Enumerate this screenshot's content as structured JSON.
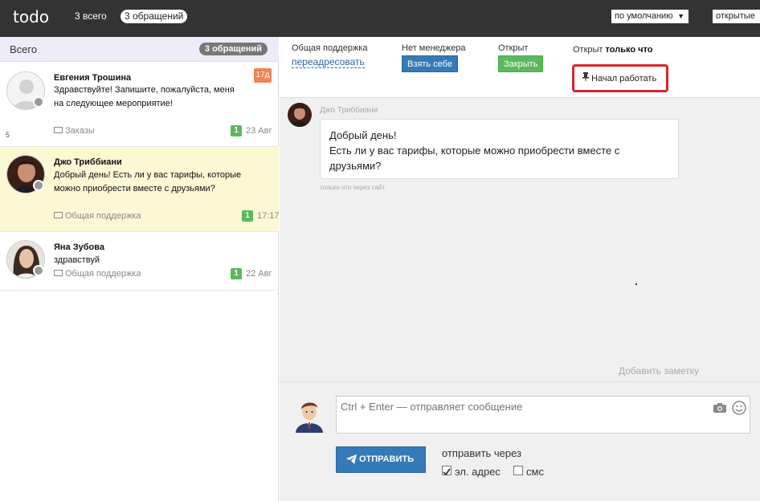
{
  "topbar": {
    "logo": "todo",
    "all_label": "3 всего",
    "requests_badge": "3 обращений",
    "sort_select": "по умолчанию",
    "filter_select": "открытые"
  },
  "sidebar": {
    "title": "Всего",
    "badge": "3 обращений",
    "side_number": "5",
    "conversations": [
      {
        "name": "Евгения Трошина",
        "age_badge": "17д",
        "text": "Здравствуйте! Запишите, пожалуйста, меня на следующее мероприятие!",
        "channel": "Заказы",
        "count": "1",
        "date": "23 Авг"
      },
      {
        "name": "Джо Триббиани",
        "text": "Добрый день! Есть ли у вас тарифы, которые можно приобрести вместе с друзьями?",
        "channel": "Общая поддержка",
        "count": "1",
        "date": "17:17"
      },
      {
        "name": "Яна Зубова",
        "text": "здравствуй",
        "channel": "Общая поддержка",
        "count": "1",
        "date": "22 Авг"
      }
    ]
  },
  "info_bar": {
    "group_label": "Общая поддержка",
    "redirect_link": "переадресовать",
    "manager_label": "Нет менеджера",
    "take_button": "Взять себе",
    "open_label": "Открыт",
    "close_button": "Закрыть",
    "status_prefix": "Открыт",
    "status_time": "только что",
    "work_button": "Начал работать"
  },
  "chat": {
    "author": "Джо Триббиани",
    "message_line1": "Добрый день!",
    "message_line2": "Есть ли у вас тарифы, которые можно приобрести вместе с друзьями?",
    "footer": "только что через сайт",
    "add_note": "Добавить заметку"
  },
  "compose": {
    "placeholder": "Ctrl + Enter — отправляет сообщение",
    "send_button": "ОТПРАВИТЬ",
    "via_label": "отправить через",
    "email_option": "эл. адрес",
    "email_checked": true,
    "sms_option": "смс",
    "sms_checked": false
  },
  "colors": {
    "topbar": "#333333",
    "primary_button": "#357ab8",
    "success_button": "#5cb85c",
    "age_badge": "#f0834f",
    "highlight_border": "#d9262d",
    "active_row": "#fbf8d3"
  },
  "icons": [
    "person-placeholder-icon",
    "envelope-icon",
    "pin-icon",
    "camera-icon",
    "smile-icon",
    "paper-plane-icon",
    "dropdown-arrow-icon"
  ]
}
